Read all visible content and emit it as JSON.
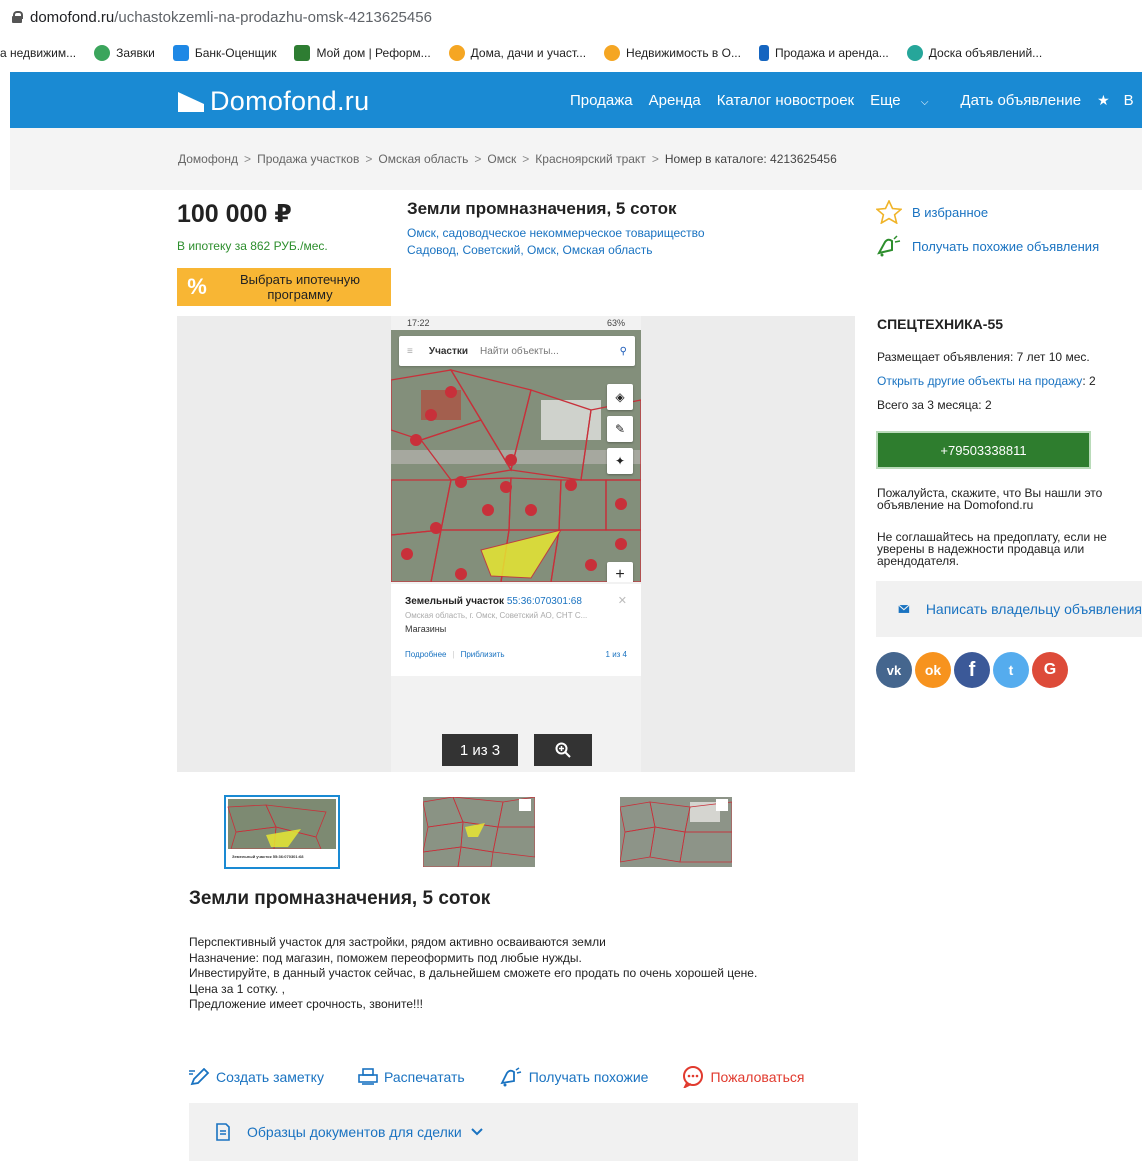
{
  "browser": {
    "url_domain": "domofond.ru",
    "url_path": "/uchastokzemli-na-prodazhu-omsk-4213625456",
    "bookmarks": [
      {
        "label": "а недвижим...",
        "color": ""
      },
      {
        "label": "Заявки",
        "color": "#3ba55c"
      },
      {
        "label": "Банк-Оценщик",
        "color": "#1e88e5"
      },
      {
        "label": "Мой дом | Реформ...",
        "color": "#2e7d32"
      },
      {
        "label": "Дома, дачи и участ...",
        "color": "#f5a623"
      },
      {
        "label": "Недвижимость в О...",
        "color": "#f5a623"
      },
      {
        "label": "Продажа и аренда...",
        "color": "#1565c0"
      },
      {
        "label": "Доска объявлений...",
        "color": "#f5a623"
      }
    ]
  },
  "header": {
    "logo": "Domofond.ru",
    "nav": [
      "Продажа",
      "Аренда",
      "Каталог новостроек",
      "Еще",
      "Дать объявление",
      "В"
    ],
    "star_icon": "star-icon"
  },
  "breadcrumbs": {
    "items": [
      "Домофонд",
      "Продажа участков",
      "Омская область",
      "Омск",
      "Красноярский тракт"
    ],
    "catalog": "Номер в каталоге: 4213625456"
  },
  "listing": {
    "price": "100 000 ₽",
    "mortgage_text": "В ипотеку за 862 РУБ./мес.",
    "mortgage_button_pct": "%",
    "mortgage_button": "Выбрать ипотечную программу",
    "title": "Земли промназначения, 5 соток",
    "address_line1": "Омск, садоводческое некоммерческое товарищество",
    "address_line2": "Садовод, Советский, Омск, Омская область"
  },
  "gallery": {
    "status_time": "17:22",
    "status_battery": "63%",
    "search_tab": "Участки",
    "search_placeholder": "Найти объекты...",
    "plot_title": "Земельный участок",
    "plot_id": "55:36:070301:68",
    "plot_address": "Омская область, г. Омск, Советский АО, СНТ С...",
    "plot_type": "Магазины",
    "link_more": "Подробнее",
    "link_zoom": "Приблизить",
    "page_of": "1 из 4",
    "counter": "1 из 3",
    "thumb_caption": "Земельный участок 55:36:070301:68"
  },
  "description": {
    "title": "Земли промназначения, 5 соток",
    "lines": [
      "Перспективный участок для застройки, рядом активно осваиваются земли",
      "Назначение: под магазин, поможем переоформить под любые нужды.",
      "Инвестируйте, в данный участок сейчас, в дальнейшем сможете его продать по очень хорошей цене.",
      "Цена за 1 сотку. ,",
      "Предложение имеет срочность, звоните!!!"
    ]
  },
  "actions": {
    "note": "Создать заметку",
    "print": "Распечатать",
    "similar": "Получать похожие",
    "report": "Пожаловаться",
    "documents": "Образцы документов для сделки"
  },
  "sidebar": {
    "favorite": "В избранное",
    "similar": "Получать похожие объявления",
    "seller": "СПЕЦТЕХНИКА-55",
    "posting": "Размещает объявления: 7 лет 10 мес.",
    "other_link": "Открыть другие объекты на продажу",
    "other_count": ": 2",
    "total": "Всего за 3 месяца: 2",
    "phone": "+79503338811",
    "note1_line1": "Пожалуйста, скажите, что Вы нашли это",
    "note1_line2": "объявление на Domofond.ru",
    "note2_line1": "Не соглашайтесь на предоплату, если не",
    "note2_line2": "уверены в надежности продавца или",
    "note2_line3": "арендодателя.",
    "write_owner": "Написать владельцу объявления",
    "socials": [
      {
        "icon": "vk-icon",
        "glyph": "vk",
        "color": "#45668e"
      },
      {
        "icon": "odnoklassniki-icon",
        "glyph": "ok",
        "color": "#f7931e"
      },
      {
        "icon": "facebook-icon",
        "glyph": "f",
        "color": "#3b5998"
      },
      {
        "icon": "twitter-icon",
        "glyph": "t",
        "color": "#55acee"
      },
      {
        "icon": "google-icon",
        "glyph": "G",
        "color": "#dd4b39"
      }
    ]
  }
}
